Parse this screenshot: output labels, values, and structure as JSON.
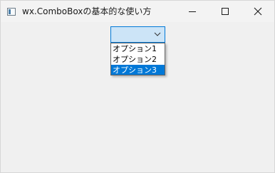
{
  "window": {
    "title": "wx.ComboBoxの基本的な使い方"
  },
  "combobox": {
    "value": "",
    "options": [
      "オプション1",
      "オプション2",
      "オプション3"
    ],
    "highlighted_option": "オプション3"
  },
  "colors": {
    "accent": "#0078d7",
    "combo_background": "#cce4f7",
    "window_background": "#f0f0f0"
  },
  "icons": {
    "app": "app-window-icon",
    "minimize": "minimize-icon",
    "maximize": "maximize-icon",
    "close": "close-icon",
    "dropdown": "chevron-down-icon"
  }
}
